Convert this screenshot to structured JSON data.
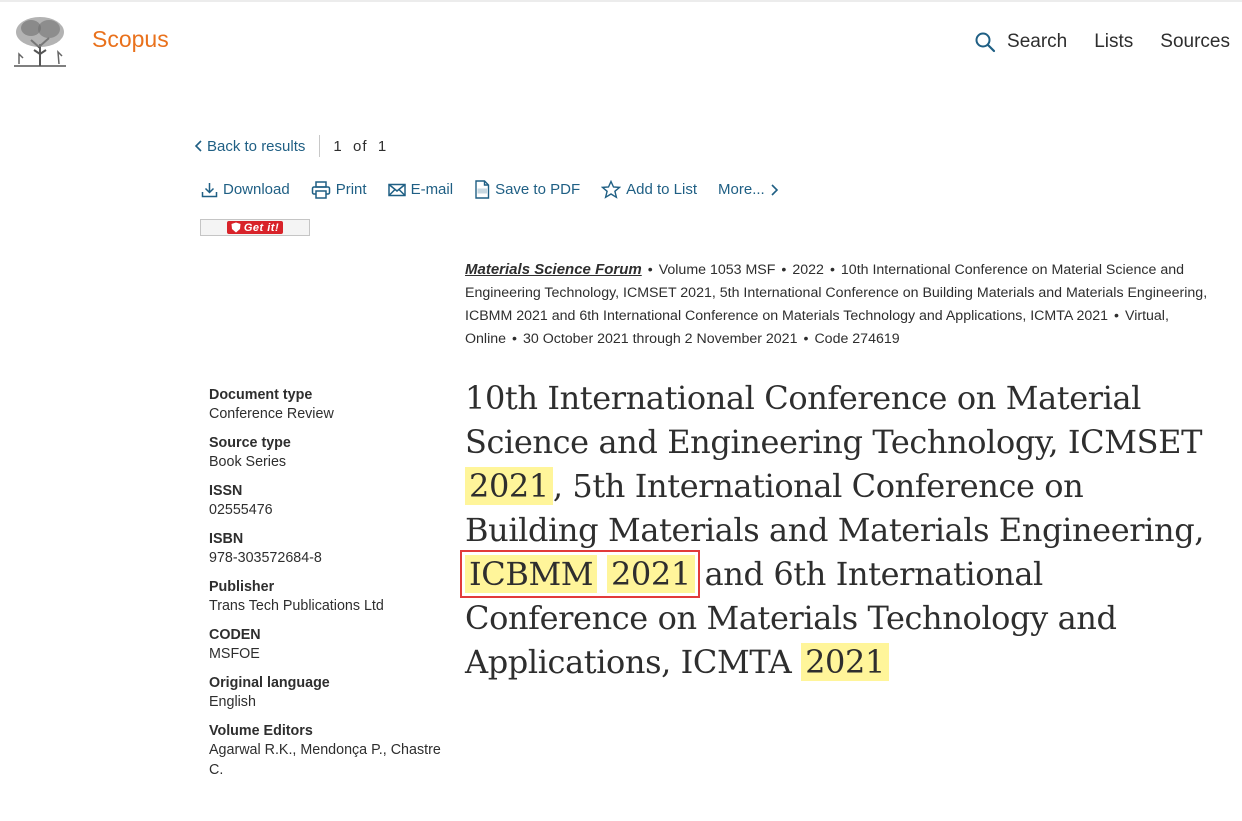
{
  "header": {
    "brand": "Scopus",
    "nav": [
      "Search",
      "Lists",
      "Sources"
    ]
  },
  "navigation": {
    "back": "Back to results",
    "pager": "1  of  1"
  },
  "actions": [
    "Download",
    "Print",
    "E-mail",
    "Save to PDF",
    "Add to List",
    "More..."
  ],
  "getit": "Get it!",
  "source": {
    "journal": "Materials Science Forum",
    "volume": "Volume 1053 MSF",
    "year": "2022",
    "conference": "10th International Conference on Material Science and Engineering Technology, ICMSET 2021, 5th International Conference on Building Materials and Materials Engineering, ICBMM 2021 and 6th International Conference on Materials Technology and Applications, ICMTA 2021",
    "location": "Virtual, Online",
    "dates": "30 October 2021 through 2 November 2021",
    "code": "Code 274619"
  },
  "title_parts": [
    "10th International Conference on Material Science and Engineering Technology, ICMSET ",
    "2021",
    ", 5th International Conference on Building Materials and Materials Engineering, ",
    "ICBMM",
    "2021",
    " and 6th International Conference on Materials Technology and Applications, ICMTA ",
    "2021"
  ],
  "meta": [
    {
      "label": "Document type",
      "value": "Conference Review"
    },
    {
      "label": "Source type",
      "value": "Book Series"
    },
    {
      "label": "ISSN",
      "value": "02555476"
    },
    {
      "label": "ISBN",
      "value": "978-303572684-8"
    },
    {
      "label": "Publisher",
      "value": "Trans Tech Publications Ltd"
    },
    {
      "label": "CODEN",
      "value": "MSFOE"
    },
    {
      "label": "Original language",
      "value": "English"
    },
    {
      "label": "Volume Editors",
      "value": "Agarwal R.K., Mendonça P., Chastre C."
    }
  ],
  "colors": {
    "brand": "#e9711c",
    "link": "#1f5f84",
    "highlight": "#fff59a",
    "annotation_box": "#e23a3a"
  }
}
